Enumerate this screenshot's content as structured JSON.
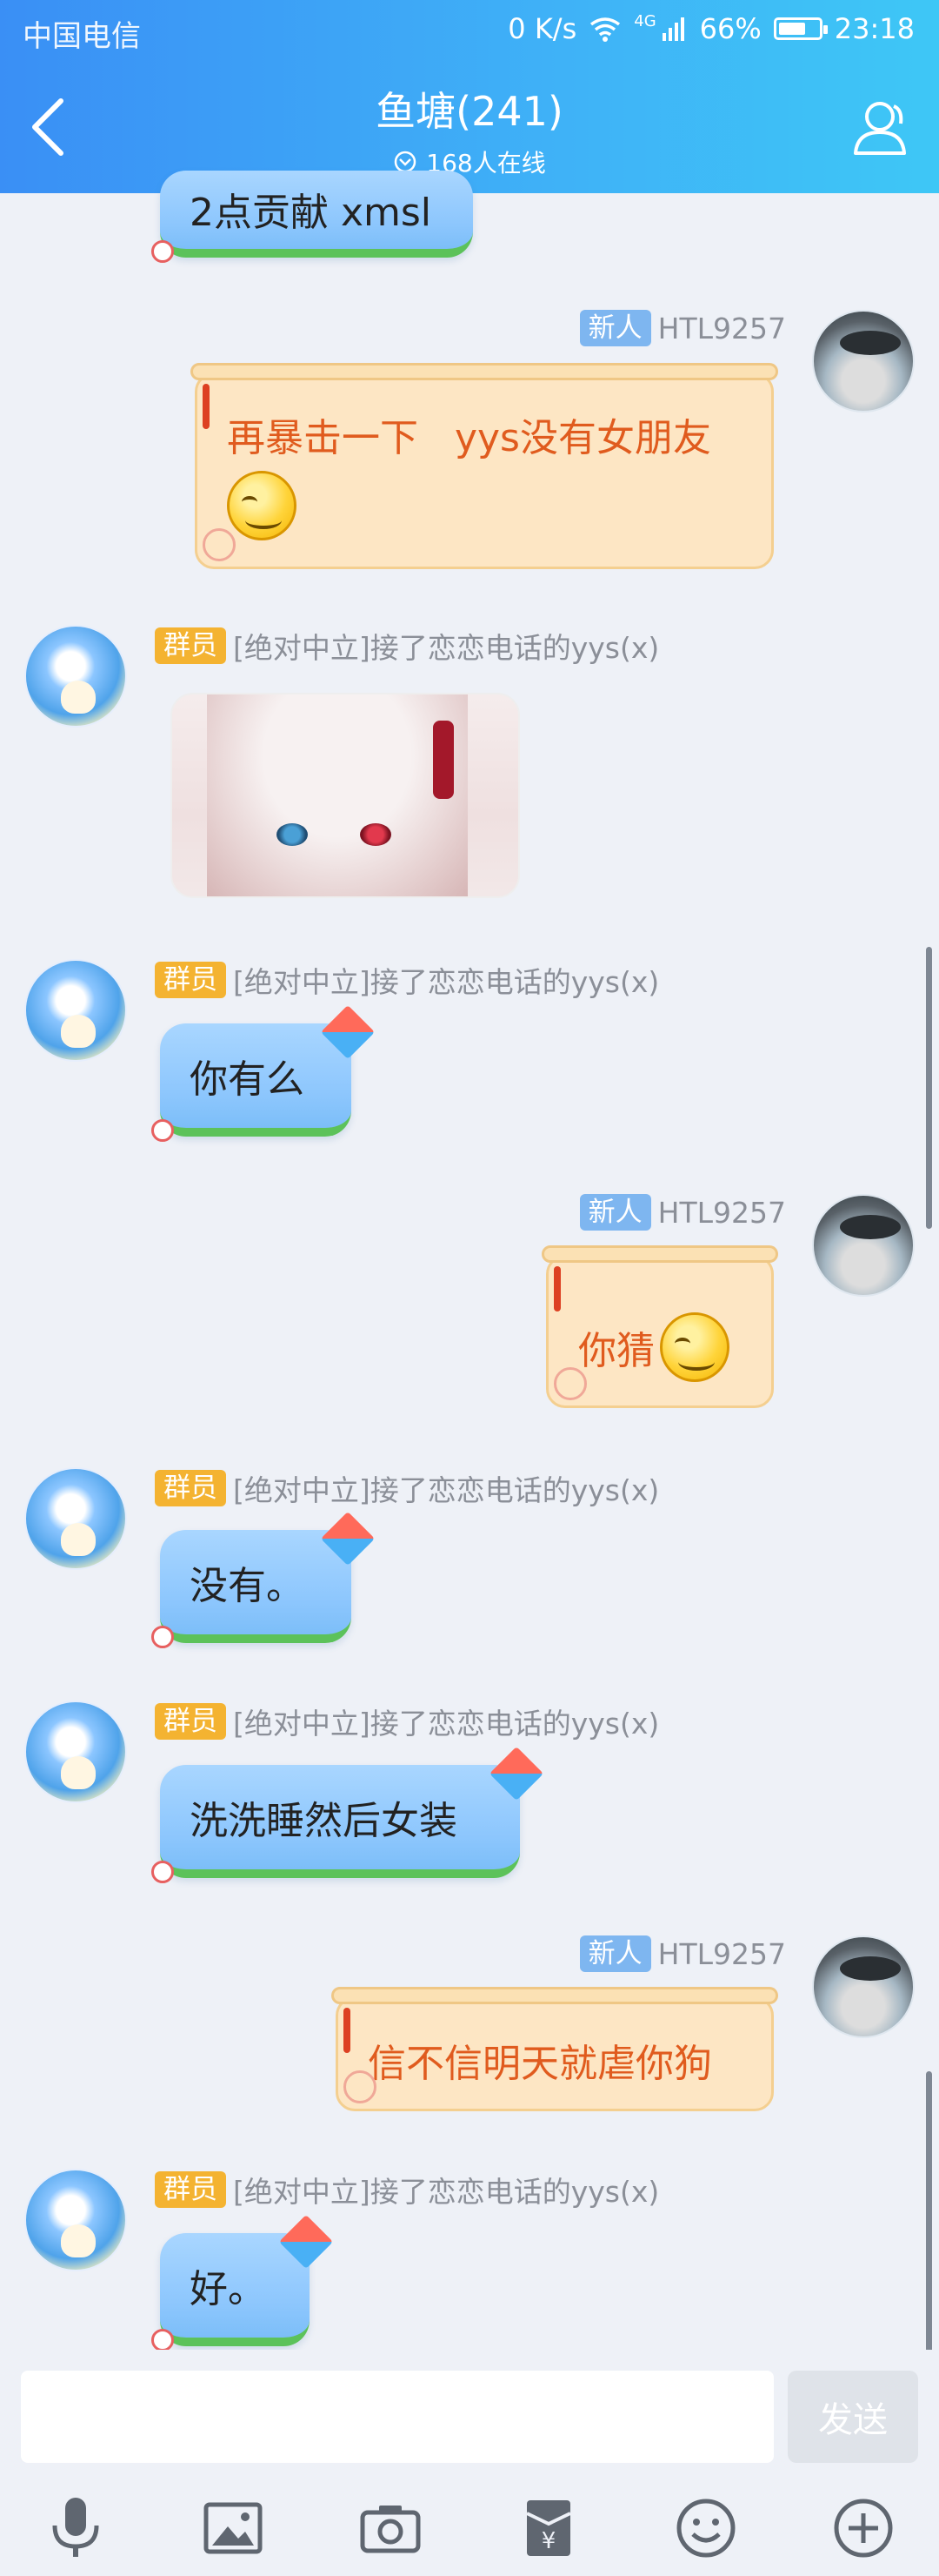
{
  "status_bar": {
    "carrier": "中国电信",
    "network_speed": "0 K/s",
    "network_type": "4G",
    "battery": "66%",
    "time": "23:18"
  },
  "header": {
    "title": "鱼塘(241)",
    "online": "168人在线"
  },
  "messages": [
    {
      "text_partial": "2点贡献 xmsl"
    },
    {
      "badge": "新人",
      "name": "HTL9257",
      "text": "再暴击一下   yys没有女朋友"
    },
    {
      "badge": "群员",
      "name": "[绝对中立]接了恋恋电话的yys(x)",
      "type": "image"
    },
    {
      "badge": "群员",
      "name": "[绝对中立]接了恋恋电话的yys(x)",
      "text": "你有么"
    },
    {
      "badge": "新人",
      "name": "HTL9257",
      "text": "你猜"
    },
    {
      "badge": "群员",
      "name": "[绝对中立]接了恋恋电话的yys(x)",
      "text": "没有。"
    },
    {
      "badge": "群员",
      "name": "[绝对中立]接了恋恋电话的yys(x)",
      "text": "洗洗睡然后女装"
    },
    {
      "badge": "新人",
      "name": "HTL9257",
      "text": "信不信明天就虐你狗"
    },
    {
      "badge": "群员",
      "name": "[绝对中立]接了恋恋电话的yys(x)",
      "text": "好。"
    }
  ],
  "input": {
    "placeholder": "",
    "send_label": "发送"
  },
  "toolbar_icons": [
    "microphone-icon",
    "image-icon",
    "camera-icon",
    "red-packet-icon",
    "emoji-icon",
    "plus-icon"
  ],
  "colors": {
    "header_start": "#3a8ff5",
    "header_end": "#3ec7f6",
    "member_badge": "#f4b331",
    "new_badge": "#7eb6f0",
    "scroll_text": "#e05b1e"
  }
}
